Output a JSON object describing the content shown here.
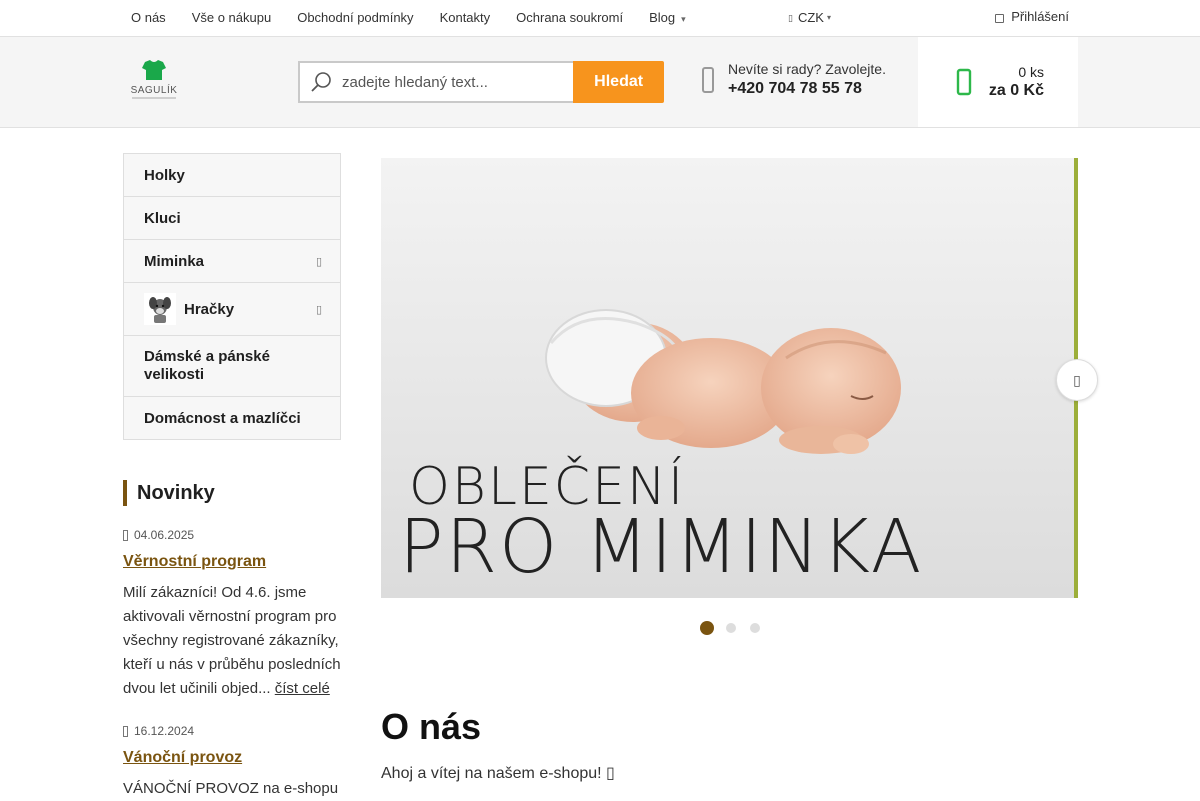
{
  "topnav": {
    "items": [
      "O nás",
      "Vše o nákupu",
      "Obchodní podmínky",
      "Kontakty",
      "Ochrana soukromí",
      "Blog"
    ],
    "blog_caret": "▾",
    "currency": "CZK",
    "login": "Přihlášení"
  },
  "header": {
    "logo_text": "SAGULÍK",
    "search_placeholder": "zadejte hledaný text...",
    "search_button": "Hledat",
    "contact_line1": "Nevíte si rady? Zavolejte.",
    "contact_phone": "+420 704 78 55 78",
    "cart_count": "0 ks",
    "cart_total": "za 0 Kč"
  },
  "menu": {
    "items": [
      "Holky",
      "Kluci",
      "Miminka",
      "Hračky",
      "Dámské a pánské velikosti",
      "Domácnost a mazlíčci"
    ]
  },
  "banner": {
    "line1": "OBLEČENÍ",
    "line2": "PRO MIMINKA",
    "active_slide": 1,
    "slide_count": 3
  },
  "news": {
    "heading": "Novinky",
    "items": [
      {
        "date": "04.06.2025",
        "title": "Věrnostní program",
        "text": "Milí zákazníci! Od 4.6. jsme aktivovali věrnostní program pro všechny registrované zákazníky, kteří u nás v průběhu posledních dvou let učinili objed...",
        "more": "číst celé"
      },
      {
        "date": "16.12.2024",
        "title": "Vánoční provoz",
        "text": "VÁNOČNÍ PROVOZ na e-shopu"
      }
    ]
  },
  "about": {
    "title": "O nás",
    "text": "Ahoj a vítej na našem e-shopu! "
  },
  "colors": {
    "accent_orange": "#f7941d",
    "brand_brown": "#7a5410",
    "cart_green": "#2db84a"
  }
}
